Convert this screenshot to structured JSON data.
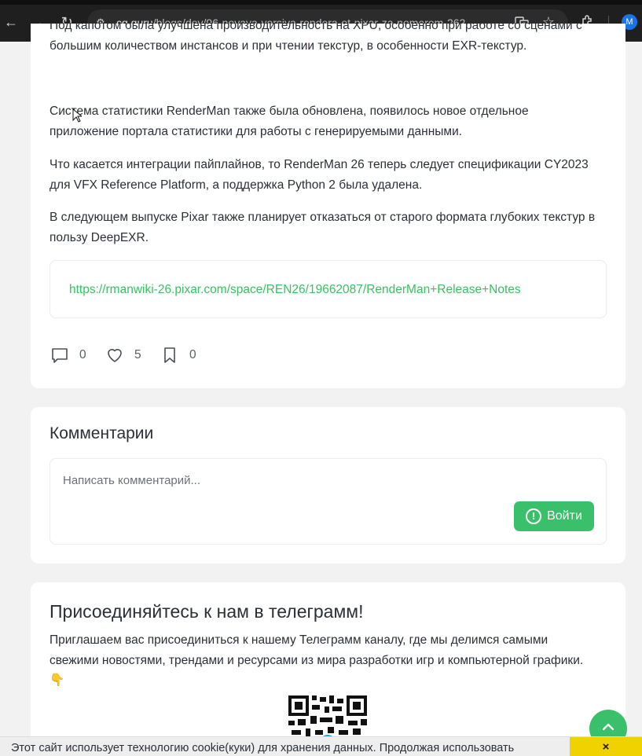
{
  "browser": {
    "url_host": "cg.guru",
    "url_path": "/blogs/dev/96-novaya-versiya-rendera-ot-pixar-za-nomerom-262",
    "profile_initial": "M"
  },
  "article": {
    "partial_text": "Под капотом была улучшена производительность на XPU, особенно при работе со сценами с большим количеством инстансов и при чтении текстур, в особенности EXR-текстур.",
    "paragraphs": [
      "Система статистики RenderMan также была обновлена, появилось новое отдельное приложение портала статистики для работы с генерируемыми данными.",
      "Что касается интеграции пайплайнов, то RenderMan 26 теперь следует спецификации CY2023 для VFX Reference Platform, а поддержка Python 2 была удалена.",
      "В следующем выпуске Pixar также планирует отказаться от старого формата глубоких текстур в пользу DeepEXR."
    ],
    "link": "https://rmanwiki-26.pixar.com/space/REN26/19662087/RenderMan+Release+Notes",
    "stats": {
      "comments": "0",
      "likes": "5",
      "bookmarks": "0"
    }
  },
  "comments_section": {
    "title": "Комментарии",
    "placeholder": "Написать комментарий...",
    "login_label": "Войти"
  },
  "telegram_section": {
    "title": "Присоединяйтесь к нам в телеграмм!",
    "text": "Приглашаем вас присоединиться к нашему Телеграмм каналу, где мы делимся самыми свежими новостями, трендами и ресурсами из мира разработки игр и компьютерной графики. 👇"
  },
  "cookie": {
    "text": "Этот сайт использует технологию cookie(куки) для хранения данных. Продолжая использовать",
    "close_label": "×"
  },
  "colors": {
    "accent": "#3ac06a",
    "link": "#3bbf62",
    "cookie_button": "#f0d200"
  }
}
